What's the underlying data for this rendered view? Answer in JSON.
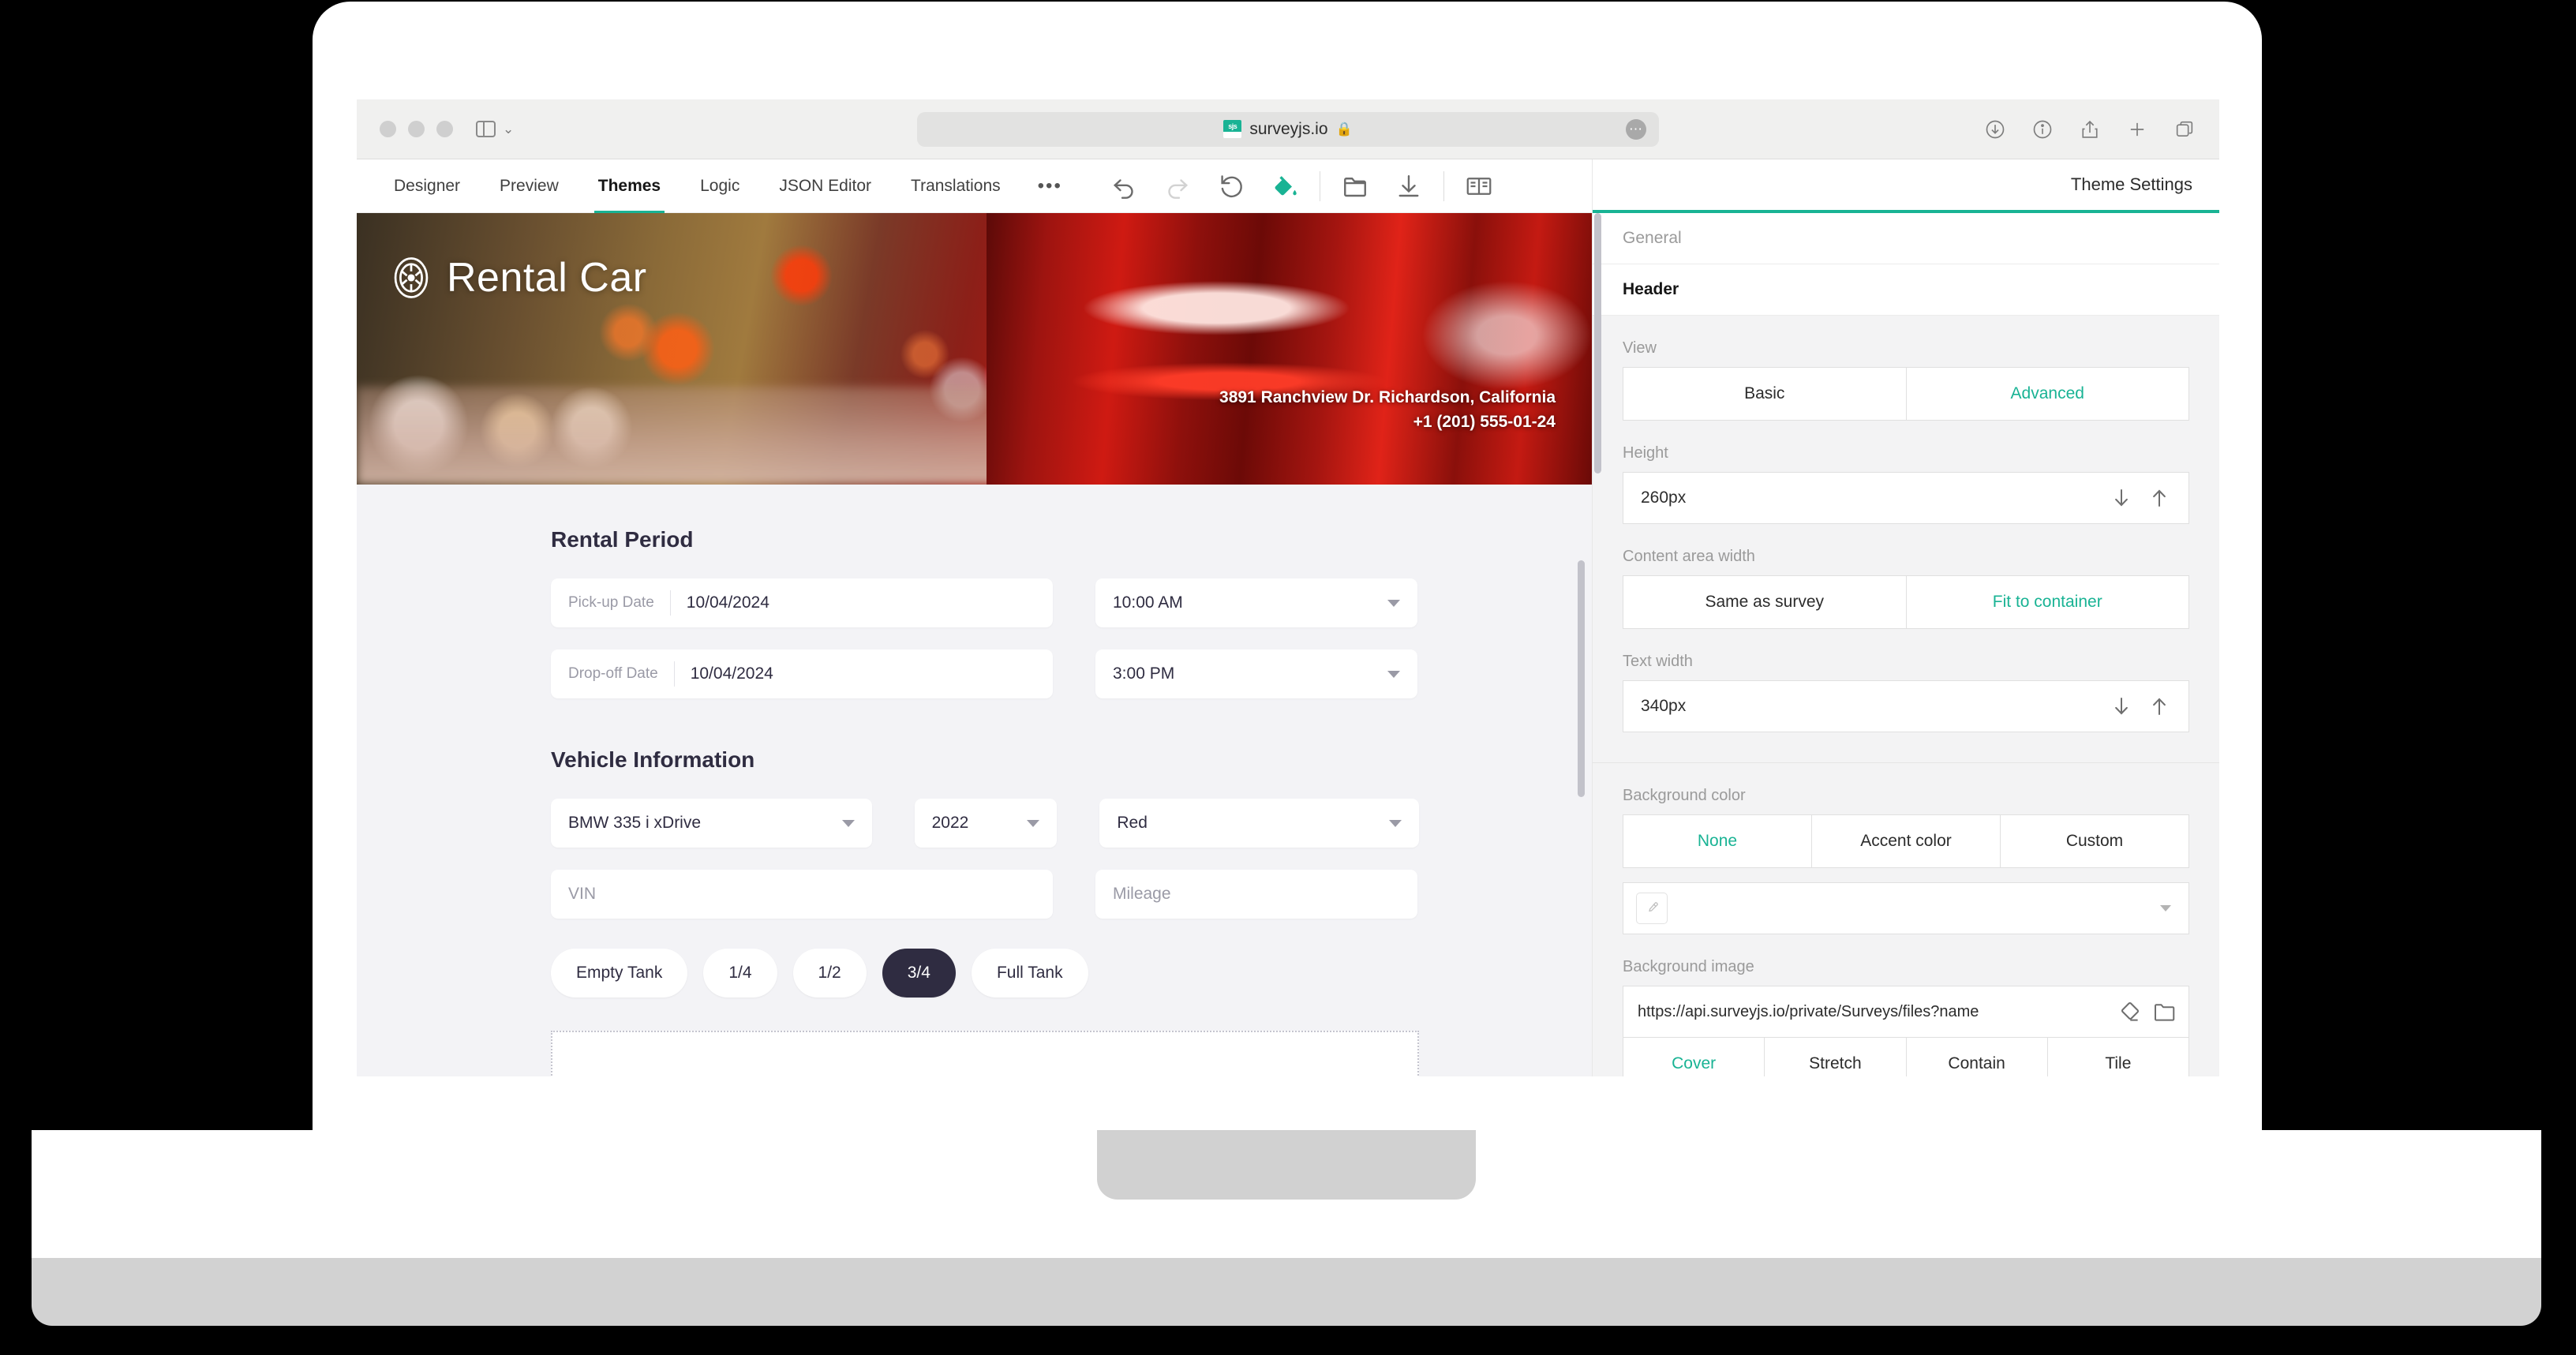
{
  "browser": {
    "url": "surveyjs.io",
    "favicon_label": "sjs",
    "lock_icon": "lock-icon",
    "traffic_lights": [
      "close",
      "minimize",
      "maximize"
    ],
    "sidebar_icon": "sidebar-icon",
    "chevron_icon": "chevron-down-icon",
    "page_menu_icon": "ellipsis-icon",
    "right_icons": [
      "download-icon",
      "info-icon",
      "share-icon",
      "new-tab-icon",
      "tabs-overview-icon"
    ]
  },
  "editor": {
    "tabs": [
      {
        "label": "Designer",
        "active": false
      },
      {
        "label": "Preview",
        "active": false
      },
      {
        "label": "Themes",
        "active": true
      },
      {
        "label": "Logic",
        "active": false
      },
      {
        "label": "JSON Editor",
        "active": false
      },
      {
        "label": "Translations",
        "active": false
      }
    ],
    "overflow_label": "•••",
    "toolbar_icons": [
      {
        "name": "undo-icon",
        "state": "enabled"
      },
      {
        "name": "redo-icon",
        "state": "disabled"
      },
      {
        "name": "reset-icon",
        "state": "enabled"
      },
      {
        "name": "theme-fill-icon",
        "state": "accent"
      },
      {
        "name": "open-file-icon",
        "state": "enabled"
      },
      {
        "name": "download-icon",
        "state": "enabled"
      },
      {
        "name": "preview-pages-icon",
        "state": "enabled"
      }
    ],
    "accent_color": "#19b394"
  },
  "survey": {
    "banner": {
      "logo_icon": "steering-wheel-icon",
      "title": "Rental Car",
      "address": "3891 Ranchview Dr. Richardson, California",
      "phone": "+1 (201) 555-01-24"
    },
    "sections": [
      {
        "title": "Rental Period",
        "fields": [
          {
            "name": "pickup-date",
            "label": "Pick-up Date",
            "value": "10/04/2024",
            "type": "date"
          },
          {
            "name": "pickup-time",
            "value": "10:00 AM",
            "type": "select"
          },
          {
            "name": "dropoff-date",
            "label": "Drop-off Date",
            "value": "10/04/2024",
            "type": "date"
          },
          {
            "name": "dropoff-time",
            "value": "3:00 PM",
            "type": "select"
          }
        ]
      },
      {
        "title": "Vehicle Information",
        "fields": [
          {
            "name": "vehicle-model",
            "value": "BMW 335 i xDrive",
            "type": "select"
          },
          {
            "name": "vehicle-year",
            "value": "2022",
            "type": "select"
          },
          {
            "name": "vehicle-color",
            "value": "Red",
            "type": "select"
          },
          {
            "name": "vin",
            "placeholder": "VIN",
            "value": "",
            "type": "text"
          },
          {
            "name": "mileage",
            "placeholder": "Mileage",
            "value": "",
            "type": "text"
          }
        ],
        "fuel_level": {
          "options": [
            "Empty Tank",
            "1/4",
            "1/2",
            "3/4",
            "Full Tank"
          ],
          "selected": "3/4",
          "selected_color": "#2f2c41"
        }
      }
    ]
  },
  "theme_panel": {
    "title": "Theme Settings",
    "groups": [
      {
        "name": "General",
        "label": "General",
        "bold": false
      },
      {
        "name": "Header",
        "label": "Header",
        "bold": true
      }
    ],
    "header_settings": {
      "view": {
        "label": "View",
        "options": [
          "Basic",
          "Advanced"
        ],
        "selected": "Advanced"
      },
      "height": {
        "label": "Height",
        "value": "260px",
        "down_icon": "arrow-down-icon",
        "up_icon": "arrow-up-icon"
      },
      "content_area_width": {
        "label": "Content area width",
        "options": [
          "Same as survey",
          "Fit to container"
        ],
        "selected": "Fit to container"
      },
      "text_width": {
        "label": "Text width",
        "value": "340px",
        "down_icon": "arrow-down-icon",
        "up_icon": "arrow-up-icon"
      }
    },
    "background": {
      "color": {
        "label": "Background color",
        "options": [
          "None",
          "Accent color",
          "Custom"
        ],
        "selected": "None"
      },
      "color_value": {
        "swatch_icon": "eyedropper-icon",
        "value": "",
        "caret_icon": "chevron-down-icon"
      },
      "image": {
        "label": "Background image",
        "value": "https://api.surveyjs.io/private/Surveys/files?name",
        "clear_icon": "eraser-icon",
        "browse_icon": "folder-icon"
      },
      "fit": {
        "options": [
          "Cover",
          "Stretch",
          "Contain",
          "Tile"
        ],
        "selected": "Cover"
      }
    }
  }
}
